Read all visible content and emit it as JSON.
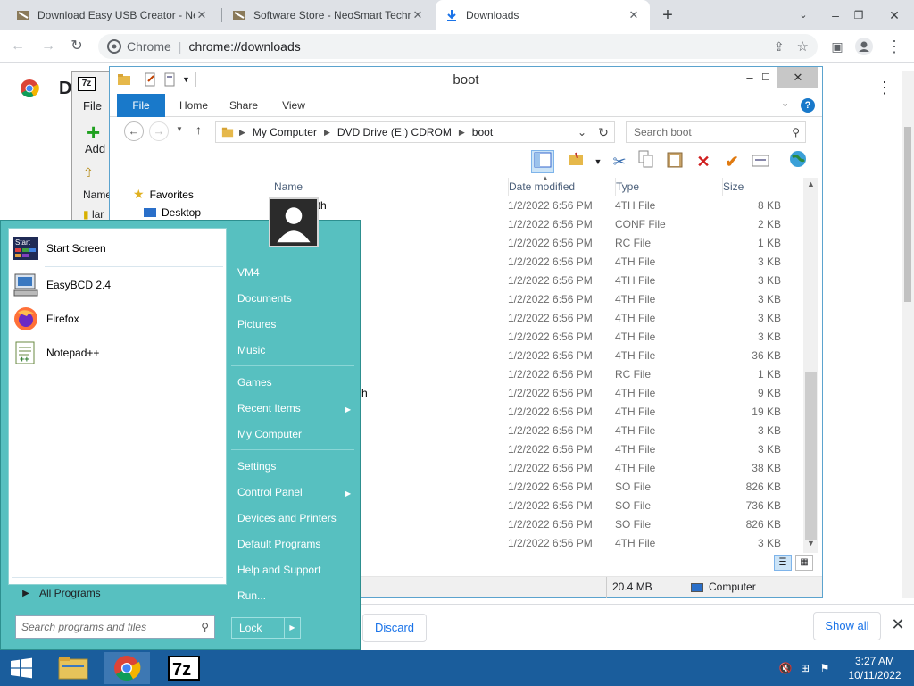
{
  "chrome": {
    "tabs": [
      {
        "title": "Download Easy USB Creator - NeoSmart",
        "active": false
      },
      {
        "title": "Software Store - NeoSmart Technologies",
        "active": false
      },
      {
        "title": "Downloads",
        "active": true
      }
    ],
    "new_tab": "+",
    "omnibox": {
      "site": "Chrome",
      "separator": "|",
      "url": "chrome://downloads"
    },
    "page_title": "D",
    "menu_glyph": "⋮",
    "shelf": {
      "discard": "Discard",
      "show_all": "Show all",
      "close": "✕"
    }
  },
  "sevenzip": {
    "logo": "7z",
    "menu_file": "File",
    "add": "Add",
    "col_name": "Name",
    "row_name": "lar"
  },
  "explorer": {
    "title": "boot",
    "ribbon_tabs": [
      "File",
      "Home",
      "Share",
      "View"
    ],
    "help": "?",
    "breadcrumb": [
      "My Computer",
      "DVD Drive (E:) CDROM",
      "boot"
    ],
    "search_placeholder": "Search boot",
    "sidebar": {
      "favorites": "Favorites",
      "desktop": "Desktop"
    },
    "columns": {
      "name": "Name",
      "date": "Date modified",
      "type": "Type",
      "size": "Size"
    },
    "files": [
      {
        "name": "....r.4th",
        "date": "1/2/2022 6:56 PM",
        "type": "4TH File",
        "size": "8 KB"
      },
      {
        "name": "",
        "date": "1/2/2022 6:56 PM",
        "type": "CONF File",
        "size": "2 KB"
      },
      {
        "name": "",
        "date": "1/2/2022 6:56 PM",
        "type": "RC File",
        "size": "1 KB"
      },
      {
        "name": ".......th",
        "date": "1/2/2022 6:56 PM",
        "type": "4TH File",
        "size": "3 KB"
      },
      {
        "name": ".........w.4th",
        "date": "1/2/2022 6:56 PM",
        "type": "4TH File",
        "size": "3 KB"
      },
      {
        "name": "..........th",
        "date": "1/2/2022 6:56 PM",
        "type": "4TH File",
        "size": "3 KB"
      },
      {
        "name": "",
        "date": "1/2/2022 6:56 PM",
        "type": "4TH File",
        "size": "3 KB"
      },
      {
        "name": ".........th",
        "date": "1/2/2022 6:56 PM",
        "type": "4TH File",
        "size": "3 KB"
      },
      {
        "name": "",
        "date": "1/2/2022 6:56 PM",
        "type": "4TH File",
        "size": "36 KB"
      },
      {
        "name": "",
        "date": "1/2/2022 6:56 PM",
        "type": "RC File",
        "size": "1 KB"
      },
      {
        "name": "...........ands.4th",
        "date": "1/2/2022 6:56 PM",
        "type": "4TH File",
        "size": "9 KB"
      },
      {
        "name": "",
        "date": "1/2/2022 6:56 PM",
        "type": "4TH File",
        "size": "19 KB"
      },
      {
        "name": "",
        "date": "1/2/2022 6:56 PM",
        "type": "4TH File",
        "size": "3 KB"
      },
      {
        "name": "",
        "date": "1/2/2022 6:56 PM",
        "type": "4TH File",
        "size": "3 KB"
      },
      {
        "name": "",
        "date": "1/2/2022 6:56 PM",
        "type": "4TH File",
        "size": "38 KB"
      },
      {
        "name": "",
        "date": "1/2/2022 6:56 PM",
        "type": "SO File",
        "size": "826 KB"
      },
      {
        "name": ".........so",
        "date": "1/2/2022 6:56 PM",
        "type": "SO File",
        "size": "736 KB"
      },
      {
        "name": ".........o",
        "date": "1/2/2022 6:56 PM",
        "type": "SO File",
        "size": "826 KB"
      },
      {
        "name": "",
        "date": "1/2/2022 6:56 PM",
        "type": "4TH File",
        "size": "3 KB"
      }
    ],
    "status": {
      "selection_size": "20.4 MB",
      "location": "Computer"
    }
  },
  "startmenu": {
    "pinned": [
      {
        "label": "Start Screen",
        "icon": "start-screen-icon"
      },
      {
        "label": "EasyBCD 2.4",
        "icon": "easybcd-icon"
      },
      {
        "label": "Firefox",
        "icon": "firefox-icon"
      },
      {
        "label": "Notepad++",
        "icon": "notepadpp-icon"
      }
    ],
    "all_programs": "All Programs",
    "search_placeholder": "Search programs and files",
    "right_items": [
      "VM4",
      "Documents",
      "Pictures",
      "Music",
      "Games",
      "Recent Items",
      "My Computer",
      "Settings",
      "Control Panel",
      "Devices and Printers",
      "Default Programs",
      "Help and Support",
      "Run..."
    ],
    "lock": "Lock",
    "start_screen_badge": "Start"
  },
  "taskbar": {
    "time": "3:27 AM",
    "date": "10/11/2022",
    "sevenzip_label": "7z"
  },
  "colors": {
    "start_menu_bg": "#57c0c0",
    "taskbar_bg": "#1a5d9c",
    "explorer_accent": "#1979ca",
    "chrome_link": "#1a73e8"
  }
}
